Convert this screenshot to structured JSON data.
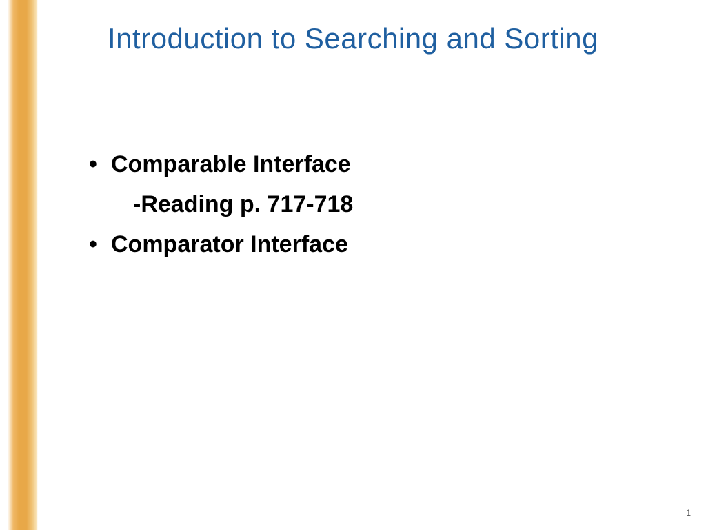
{
  "slide": {
    "title": "Introduction to Searching and Sorting",
    "bullets": [
      {
        "text": "Comparable Interface",
        "sub": "-Reading p. 717-718"
      },
      {
        "text": "Comparator Interface"
      }
    ],
    "pageNumber": "1"
  },
  "colors": {
    "titleColor": "#1f5fa0",
    "bodyColor": "#000000",
    "accentGradient": "#e8a848"
  }
}
